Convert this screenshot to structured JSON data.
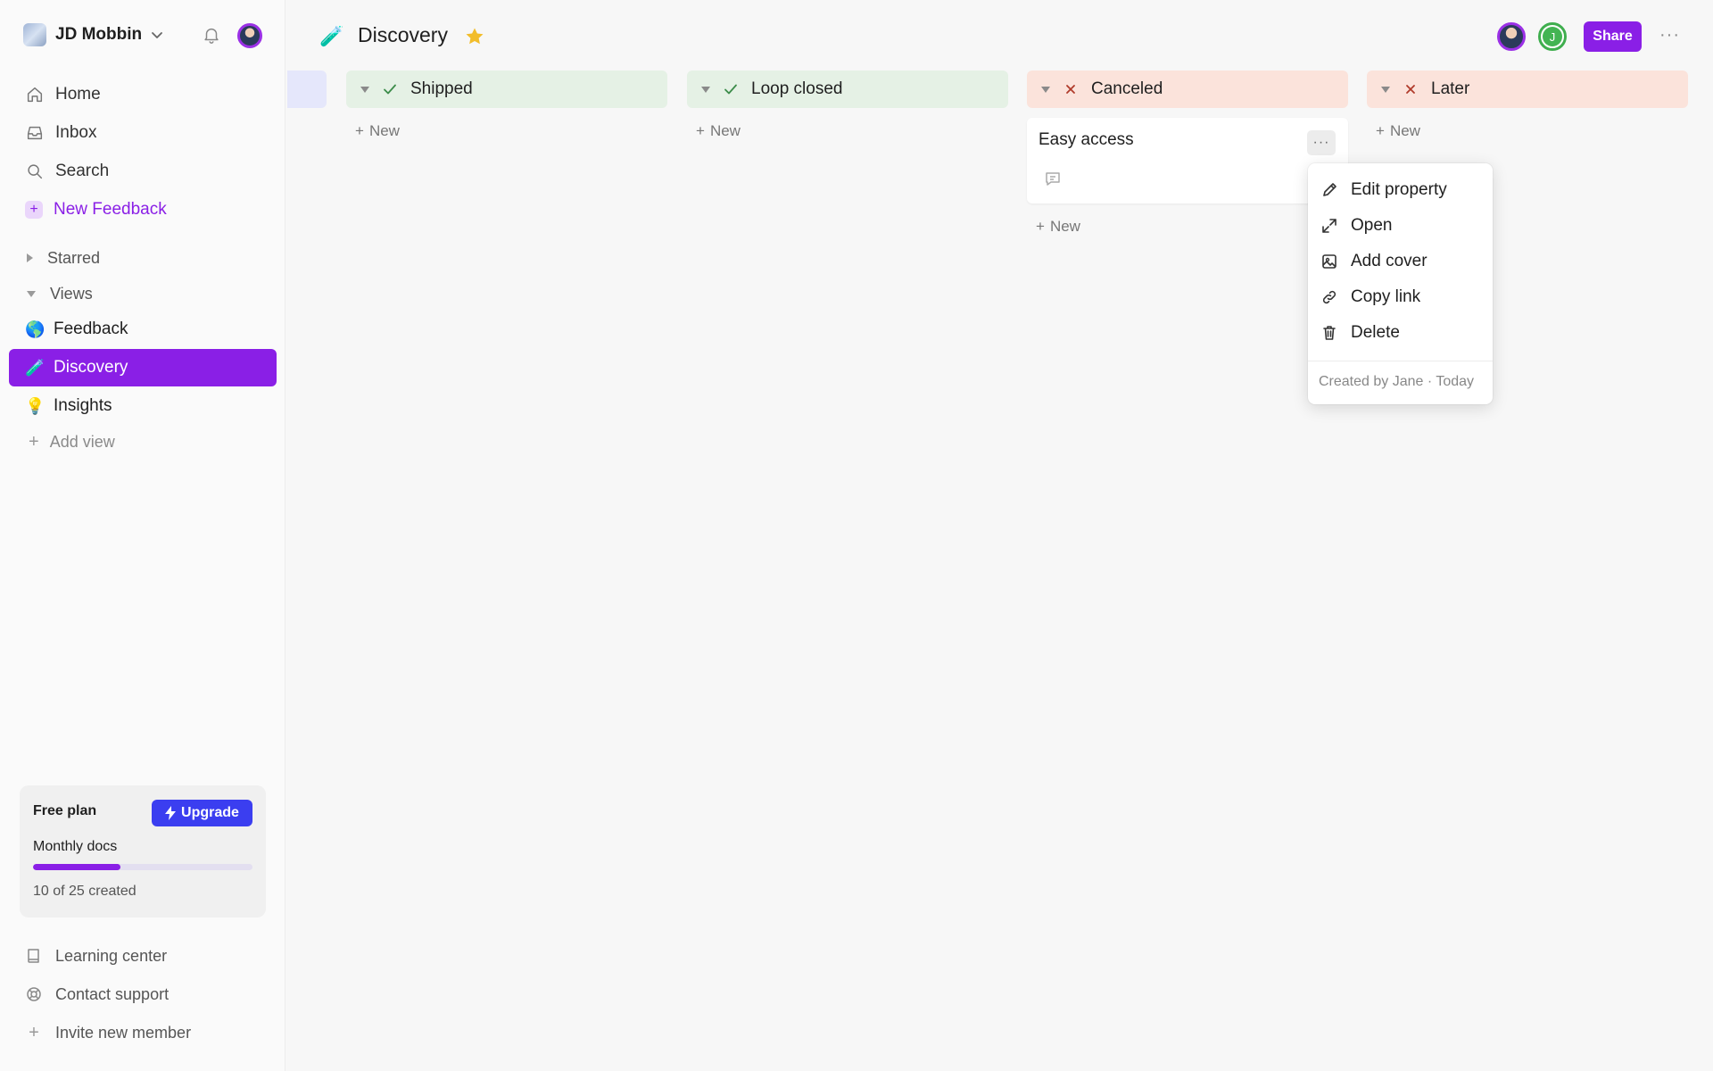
{
  "workspace": {
    "name": "JD Mobbin"
  },
  "nav": {
    "home": "Home",
    "inbox": "Inbox",
    "search": "Search",
    "new_feedback": "New Feedback"
  },
  "sections": {
    "starred": "Starred",
    "views": "Views"
  },
  "views": [
    {
      "icon": "🌎",
      "label": "Feedback"
    },
    {
      "icon": "🧪",
      "label": "Discovery"
    },
    {
      "icon": "💡",
      "label": "Insights"
    }
  ],
  "add_view": "Add view",
  "plan": {
    "title": "Free plan",
    "upgrade": "Upgrade",
    "metric": "Monthly docs",
    "progress": 0.4,
    "count": "10 of 25 created"
  },
  "footer": {
    "learning": "Learning center",
    "support": "Contact support",
    "invite": "Invite new member"
  },
  "header": {
    "icon": "🧪",
    "title": "Discovery",
    "avatar_initial": "J",
    "share": "Share",
    "more": "···"
  },
  "columns": [
    {
      "name": "Shipped",
      "status": "check",
      "new": "New"
    },
    {
      "name": "Loop closed",
      "status": "check",
      "new": "New"
    },
    {
      "name": "Canceled",
      "status": "x",
      "new": "New"
    },
    {
      "name": "Later",
      "status": "x",
      "new": "New"
    }
  ],
  "card": {
    "title": "Easy access",
    "more": "···"
  },
  "context_menu": {
    "items": [
      "Edit property",
      "Open",
      "Add cover",
      "Copy link",
      "Delete"
    ],
    "footer": "Created by Jane · Today"
  },
  "colors": {
    "accent": "#8a1fe6",
    "upgrade": "#3b3ef0",
    "green_column": "#e5f1e5",
    "red_column": "#fbe3db"
  }
}
